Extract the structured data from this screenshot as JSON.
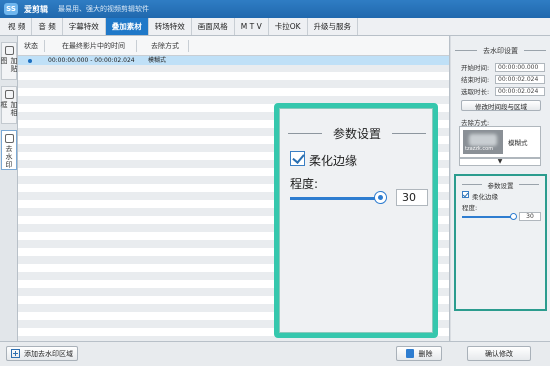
{
  "app": {
    "title": "爱剪辑",
    "slogan": "最易用、强大的视频剪辑软件",
    "logo_text": "SS"
  },
  "tabs": [
    {
      "label": "视 频"
    },
    {
      "label": "音 频"
    },
    {
      "label": "字幕特效"
    },
    {
      "label": "叠加素材",
      "active": true
    },
    {
      "label": "转场特效"
    },
    {
      "label": "画面风格"
    },
    {
      "label": "M T V"
    },
    {
      "label": "卡拉OK"
    },
    {
      "label": "升级与服务"
    }
  ],
  "side_tabs": [
    {
      "label": "加贴图",
      "active": false
    },
    {
      "label": "加相框",
      "active": false
    },
    {
      "label": "去水印",
      "active": true
    }
  ],
  "list": {
    "headers": [
      "状态",
      "在最终影片中的时间",
      "去除方式"
    ],
    "rows": [
      {
        "time": "00:00:00.000 - 00:00:02.024",
        "mode": "模糊式",
        "selected": true
      }
    ]
  },
  "bottom": {
    "add_label": "添加去水印区域",
    "delete_label": "删除",
    "confirm_label": "确认修改"
  },
  "right_panel": {
    "title": "去水印设置",
    "start_label": "开始时间:",
    "start_value": "00:00:00.000",
    "end_label": "结束时间:",
    "end_value": "00:00:02.024",
    "duration_label": "选取时长:",
    "duration_value": "00:00:02.024",
    "modify_button": "修改时间段与区域",
    "method_label": "去除方式:",
    "method_name": "模糊式",
    "thumb_url": "tzazzk.com",
    "dropdown_arrow": "▼"
  },
  "params": {
    "title": "参数设置",
    "soft_edge_label": "柔化边缘",
    "soft_edge_checked": true,
    "degree_label": "程度:",
    "degree_value": "30",
    "degree_max": 30
  },
  "colors": {
    "accent": "#1f78c8",
    "highlight_frame": "#35c7ad",
    "small_frame": "#2b9c8e"
  }
}
